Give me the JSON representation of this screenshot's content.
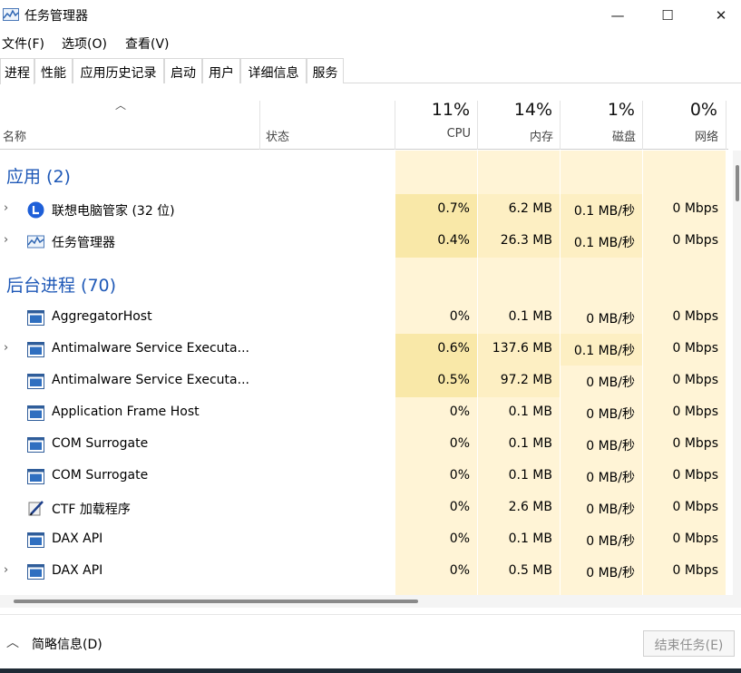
{
  "window": {
    "title": "任务管理器",
    "min_glyph": "—",
    "max_glyph": "☐",
    "close_glyph": "✕"
  },
  "menu": [
    "文件(F)",
    "选项(O)",
    "查看(V)"
  ],
  "tabs": [
    "进程",
    "性能",
    "应用历史记录",
    "启动",
    "用户",
    "详细信息",
    "服务"
  ],
  "active_tab": "进程",
  "columns": {
    "name": "名称",
    "status": "状态",
    "cpu": {
      "label": "CPU",
      "pct": "11%"
    },
    "memory": {
      "label": "内存",
      "pct": "14%"
    },
    "disk": {
      "label": "磁盘",
      "pct": "1%"
    },
    "network": {
      "label": "网络",
      "pct": "0%"
    }
  },
  "sections": {
    "apps": "应用 (2)",
    "background": "后台进程 (70)"
  },
  "rows": [
    {
      "expandable": true,
      "icon": "lenovo-icon",
      "name": "联想电脑管家 (32 位)",
      "cpu": "0.7%",
      "mem": "6.2 MB",
      "disk": "0.1 MB/秒",
      "net": "0 Mbps"
    },
    {
      "expandable": true,
      "icon": "task-manager-icon",
      "name": "任务管理器",
      "cpu": "0.4%",
      "mem": "26.3 MB",
      "disk": "0.1 MB/秒",
      "net": "0 Mbps"
    },
    {
      "expandable": false,
      "icon": "window-app-icon",
      "name": "AggregatorHost",
      "cpu": "0%",
      "mem": "0.1 MB",
      "disk": "0 MB/秒",
      "net": "0 Mbps"
    },
    {
      "expandable": true,
      "icon": "window-app-icon",
      "name": "Antimalware Service Executa...",
      "cpu": "0.6%",
      "mem": "137.6 MB",
      "disk": "0.1 MB/秒",
      "net": "0 Mbps"
    },
    {
      "expandable": false,
      "icon": "window-app-icon",
      "name": "Antimalware Service Executa...",
      "cpu": "0.5%",
      "mem": "97.2 MB",
      "disk": "0 MB/秒",
      "net": "0 Mbps"
    },
    {
      "expandable": false,
      "icon": "window-app-icon",
      "name": "Application Frame Host",
      "cpu": "0%",
      "mem": "0.1 MB",
      "disk": "0 MB/秒",
      "net": "0 Mbps"
    },
    {
      "expandable": false,
      "icon": "window-app-icon",
      "name": "COM Surrogate",
      "cpu": "0%",
      "mem": "0.1 MB",
      "disk": "0 MB/秒",
      "net": "0 Mbps"
    },
    {
      "expandable": false,
      "icon": "window-app-icon",
      "name": "COM Surrogate",
      "cpu": "0%",
      "mem": "0.1 MB",
      "disk": "0 MB/秒",
      "net": "0 Mbps"
    },
    {
      "expandable": false,
      "icon": "ctf-pen-icon",
      "name": "CTF 加载程序",
      "cpu": "0%",
      "mem": "2.6 MB",
      "disk": "0 MB/秒",
      "net": "0 Mbps"
    },
    {
      "expandable": false,
      "icon": "window-app-icon",
      "name": "DAX API",
      "cpu": "0%",
      "mem": "0.1 MB",
      "disk": "0 MB/秒",
      "net": "0 Mbps"
    },
    {
      "expandable": true,
      "icon": "window-app-icon",
      "name": "DAX API",
      "cpu": "0%",
      "mem": "0.5 MB",
      "disk": "0 MB/秒",
      "net": "0 Mbps"
    }
  ],
  "footer": {
    "collapse_label": "简略信息(D)",
    "end_task_label": "结束任务(E)"
  },
  "colors": {
    "section_title": "#1f59b7",
    "heat_light": "#fff4d6",
    "heat_mid": "#fdefc3",
    "heat_strong": "#f9e8a8"
  }
}
